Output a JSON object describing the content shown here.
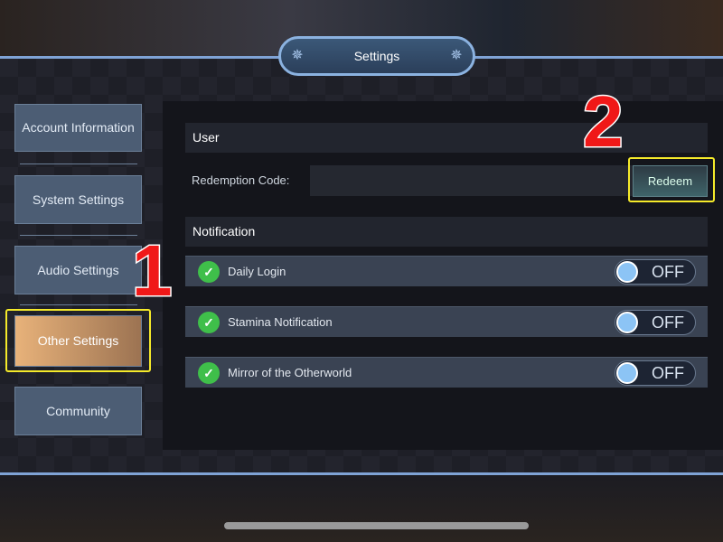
{
  "window": {
    "title": "Settings"
  },
  "sidebar": {
    "items": [
      {
        "label": "Account Information",
        "active": false
      },
      {
        "label": "System Settings",
        "active": false
      },
      {
        "label": "Audio Settings",
        "active": false
      },
      {
        "label": "Other Settings",
        "active": true
      },
      {
        "label": "Community",
        "active": false
      }
    ]
  },
  "user": {
    "header": "User",
    "redemption_label": "Redemption Code:",
    "redemption_value": "",
    "redeem_label": "Redeem"
  },
  "notification": {
    "header": "Notification",
    "items": [
      {
        "label": "Daily Login",
        "state": "OFF"
      },
      {
        "label": "Stamina Notification",
        "state": "OFF"
      },
      {
        "label": "Mirror of the Otherworld",
        "state": "OFF"
      }
    ]
  },
  "annotations": {
    "step1": "1",
    "step2": "2",
    "highlight_color": "#f5ea2a"
  },
  "colors": {
    "active_tab": "#e8b27a",
    "check": "#3fbf4a",
    "knob": "#8cc4f5"
  }
}
